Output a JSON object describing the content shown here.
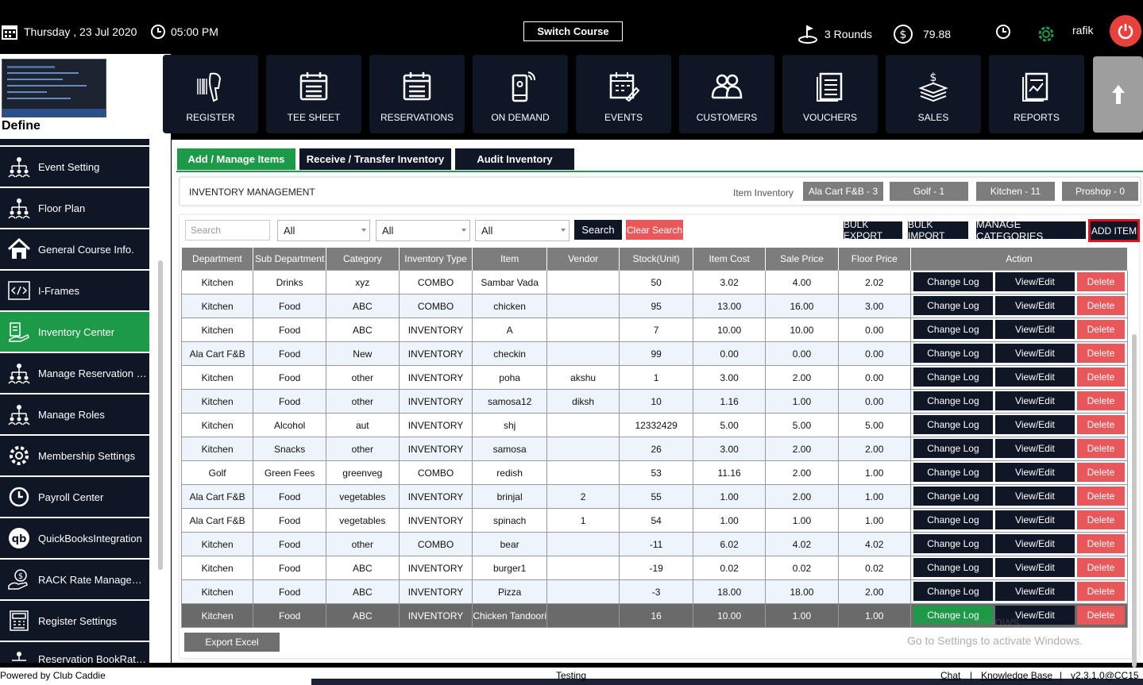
{
  "topbar": {
    "date": "Thursday ,  23 Jul 2020",
    "time": "05:00 PM",
    "switch_course": "Switch Course",
    "rounds": "3 Rounds",
    "balance": "79.88",
    "user": "rafik"
  },
  "define": {
    "label": "Define"
  },
  "sidebar": {
    "items": [
      {
        "label": "Event Setting",
        "icon": "org-chart-icon"
      },
      {
        "label": "Floor Plan",
        "icon": "org-chart-icon"
      },
      {
        "label": "General Course Info.",
        "icon": "home-icon"
      },
      {
        "label": "I-Frames",
        "icon": "code-icon"
      },
      {
        "label": "Inventory Center",
        "icon": "inventory-icon"
      },
      {
        "label": "Manage Reservation R...",
        "icon": "org-chart-icon"
      },
      {
        "label": "Manage Roles",
        "icon": "org-chart-icon"
      },
      {
        "label": "Membership Settings",
        "icon": "gear-icon"
      },
      {
        "label": "Payroll Center",
        "icon": "clock-icon"
      },
      {
        "label": "QuickBooksIntegration",
        "icon": "quickbooks-icon"
      },
      {
        "label": "RACK Rate Manageme...",
        "icon": "money-hand-icon"
      },
      {
        "label": "Register Settings",
        "icon": "register-icon"
      },
      {
        "label": "Reservation BookRate...",
        "icon": "org-chart-icon"
      }
    ]
  },
  "nav": {
    "tiles": [
      {
        "label": "REGISTER"
      },
      {
        "label": "TEE SHEET"
      },
      {
        "label": "RESERVATIONS"
      },
      {
        "label": "ON DEMAND"
      },
      {
        "label": "EVENTS"
      },
      {
        "label": "CUSTOMERS"
      },
      {
        "label": "VOUCHERS"
      },
      {
        "label": "SALES"
      },
      {
        "label": "REPORTS"
      }
    ]
  },
  "tabs": [
    "Add / Manage Items",
    "Receive / Transfer Inventory",
    "Audit Inventory"
  ],
  "inventory": {
    "title": "INVENTORY MANAGEMENT",
    "item_inventory_label": "Item Inventory",
    "chips": [
      "Ala Cart F&B - 3",
      "Golf - 1",
      "Kitchen - 11",
      "Proshop - 0"
    ]
  },
  "filters": {
    "search_placeholder": "Search",
    "select1": "All",
    "select2": "All",
    "select3": "All",
    "search_btn": "Search",
    "clear_btn": "Clear Search",
    "bulk_export": "BULK EXPORT",
    "bulk_import": "BULK IMPORT",
    "manage_categories": "MANAGE CATEGORIES",
    "add_item": "ADD ITEM"
  },
  "table": {
    "headers": [
      "Department",
      "Sub Department",
      "Category",
      "Inventory Type",
      "Item",
      "Vendor",
      "Stock(Unit)",
      "Item Cost",
      "Sale Price",
      "Floor Price",
      "Action"
    ],
    "action_labels": {
      "log": "Change Log",
      "edit": "View/Edit",
      "delete": "Delete"
    },
    "rows": [
      [
        "Kitchen",
        "Drinks",
        "xyz",
        "COMBO",
        "Sambar Vada",
        "",
        "50",
        "3.02",
        "4.00",
        "2.02"
      ],
      [
        "Kitchen",
        "Food",
        "ABC",
        "COMBO",
        "chicken",
        "",
        "95",
        "13.00",
        "16.00",
        "3.00"
      ],
      [
        "Kitchen",
        "Food",
        "ABC",
        "INVENTORY",
        "A",
        "",
        "7",
        "10.00",
        "10.00",
        "0.00"
      ],
      [
        "Ala Cart F&B",
        "Food",
        "New",
        "INVENTORY",
        "checkin",
        "",
        "99",
        "0.00",
        "0.00",
        "0.00"
      ],
      [
        "Kitchen",
        "Food",
        "other",
        "INVENTORY",
        "poha",
        "akshu",
        "1",
        "3.00",
        "2.00",
        "0.00"
      ],
      [
        "Kitchen",
        "Food",
        "other",
        "INVENTORY",
        "samosa12",
        "diksh",
        "10",
        "1.16",
        "1.00",
        "0.00"
      ],
      [
        "Kitchen",
        "Alcohol",
        "aut",
        "INVENTORY",
        "shj",
        "",
        "12332429",
        "5.00",
        "5.00",
        "5.00"
      ],
      [
        "Kitchen",
        "Snacks",
        "other",
        "INVENTORY",
        "samosa",
        "",
        "26",
        "3.00",
        "2.00",
        "2.00"
      ],
      [
        "Golf",
        "Green Fees",
        "greenveg",
        "COMBO",
        "redish",
        "",
        "53",
        "11.16",
        "2.00",
        "1.00"
      ],
      [
        "Ala Cart F&B",
        "Food",
        "vegetables",
        "INVENTORY",
        "brinjal",
        "2",
        "55",
        "1.00",
        "2.00",
        "1.00"
      ],
      [
        "Ala Cart F&B",
        "Food",
        "vegetables",
        "INVENTORY",
        "spinach",
        "1",
        "54",
        "1.00",
        "1.00",
        "1.00"
      ],
      [
        "Kitchen",
        "Food",
        "other",
        "COMBO",
        "bear",
        "",
        "-11",
        "6.02",
        "4.02",
        "4.02"
      ],
      [
        "Kitchen",
        "Food",
        "ABC",
        "INVENTORY",
        "burger1",
        "",
        "-19",
        "0.02",
        "0.02",
        "0.02"
      ],
      [
        "Kitchen",
        "Food",
        "ABC",
        "INVENTORY",
        "Pizza",
        "",
        "-3",
        "18.00",
        "18.00",
        "2.00"
      ],
      [
        "Kitchen",
        "Food",
        "ABC",
        "INVENTORY",
        "Chicken Tandoori",
        "",
        "16",
        "10.00",
        "1.00",
        "1.00"
      ]
    ]
  },
  "export_excel": "Export Excel",
  "watermark": {
    "line1": "Activate Windows",
    "line2": "Go to Settings to activate Windows."
  },
  "footer": {
    "powered": "Powered by Club Caddie",
    "center": "Testing",
    "chat": "Chat",
    "sep": "|",
    "kb": "Knowledge Base",
    "version": "v2.3.1.0@CC15"
  },
  "colors": {
    "accent_green": "#1c9a47",
    "dark_navy": "#0f1626",
    "danger": "#e8585a",
    "highlight_border": "#e0101c"
  }
}
